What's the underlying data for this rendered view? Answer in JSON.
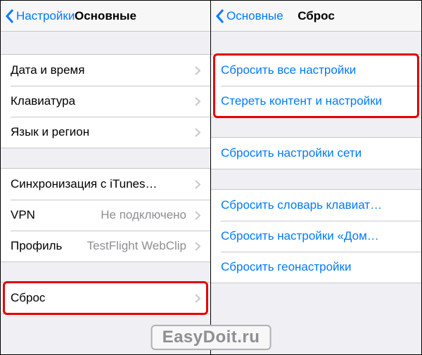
{
  "left": {
    "back": "Настройки",
    "title": "Основные",
    "group1": [
      {
        "label": "Дата и время"
      },
      {
        "label": "Клавиатура"
      },
      {
        "label": "Язык и регион"
      }
    ],
    "group2": [
      {
        "label": "Синхронизация с iTunes…"
      },
      {
        "label": "VPN",
        "value": "Не подключено"
      },
      {
        "label": "Профиль",
        "value": "TestFlight WebClip"
      }
    ],
    "group3": [
      {
        "label": "Сброс"
      }
    ]
  },
  "right": {
    "back": "Основные",
    "title": "Сброс",
    "group1": [
      "Сбросить все настройки",
      "Стереть контент и настройки"
    ],
    "group2": [
      "Сбросить настройки сети"
    ],
    "group3": [
      "Сбросить словарь клавиат…",
      "Сбросить настройки «Дом…",
      "Сбросить геонастройки"
    ]
  },
  "watermark": "EasyDoit.ru"
}
